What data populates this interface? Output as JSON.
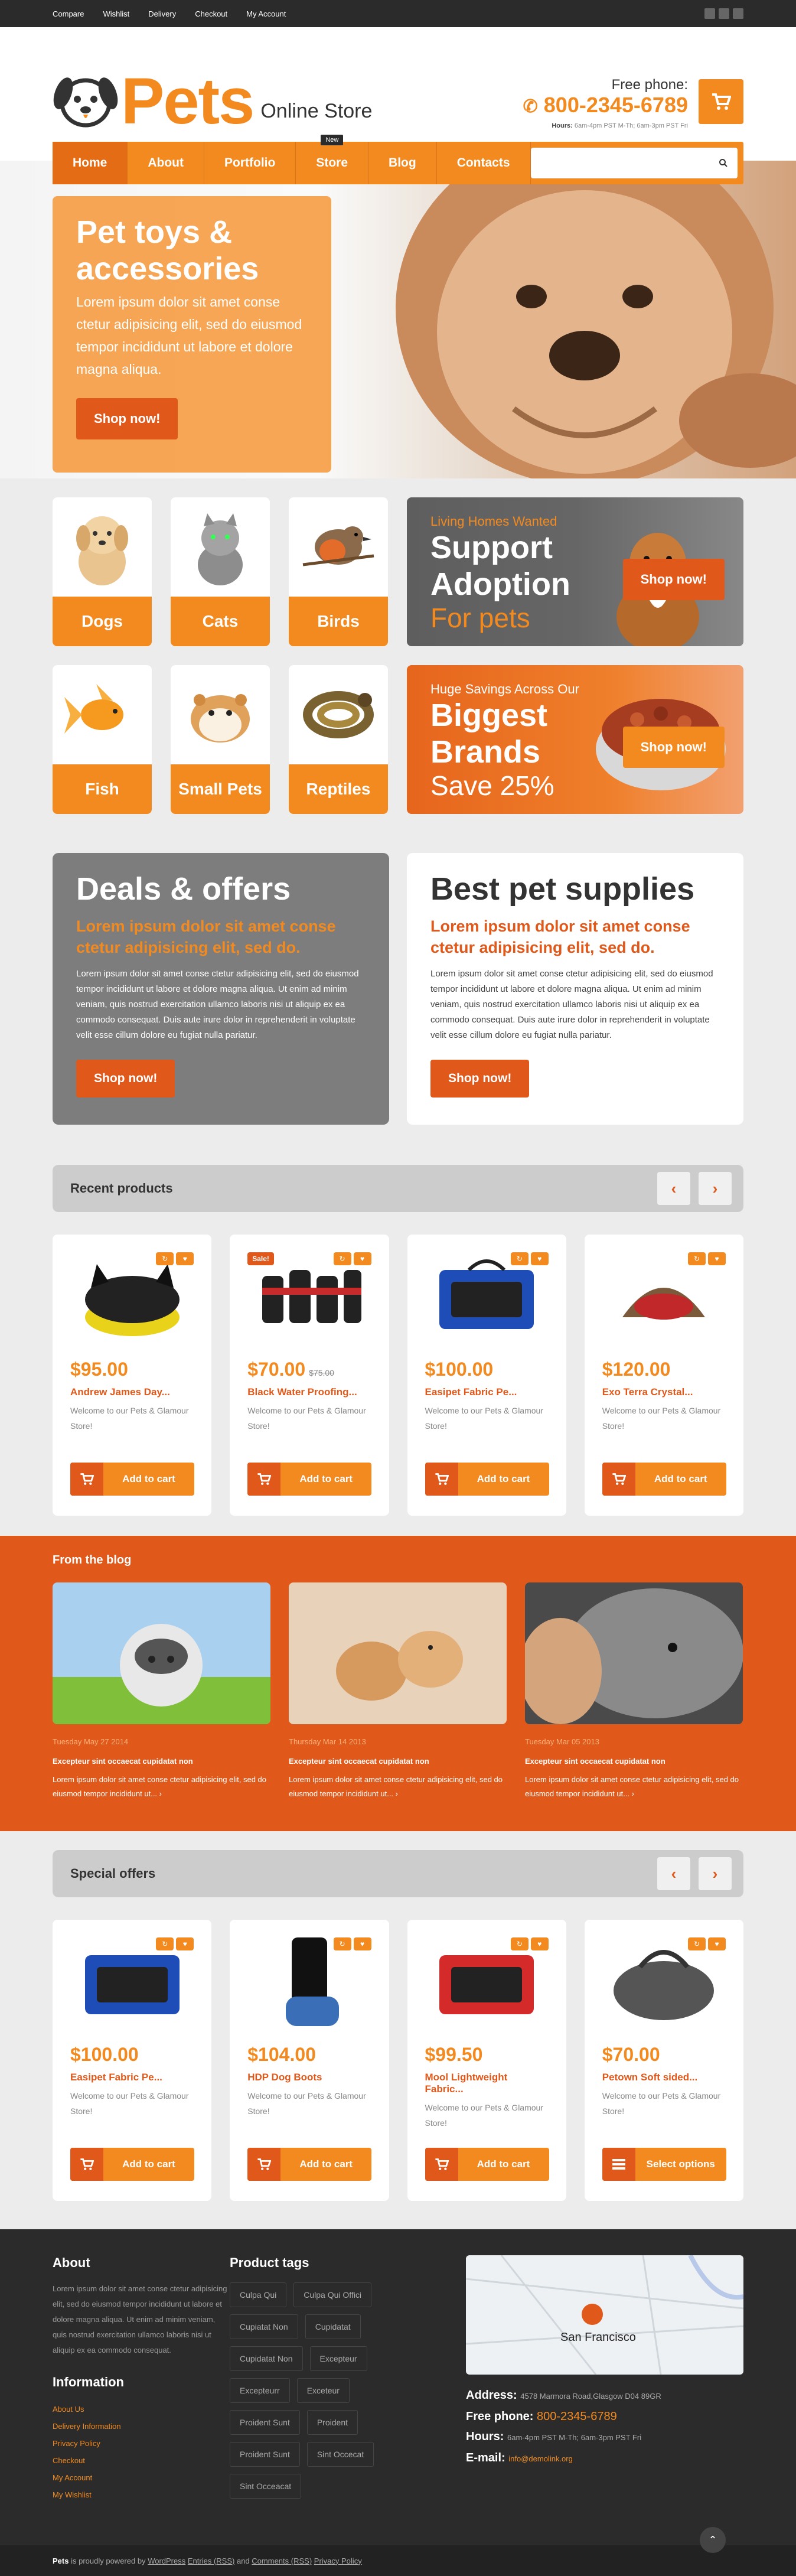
{
  "topbar": {
    "links": [
      "Compare",
      "Wishlist",
      "Delivery",
      "Checkout",
      "My Account"
    ],
    "social": [
      "facebook-icon",
      "twitter-icon",
      "instagram-icon"
    ]
  },
  "header": {
    "logo_word": "Pets",
    "logo_sub": "Online Store",
    "phone_label": "Free phone:",
    "phone": "800-2345-6789",
    "hours_label": "Hours:",
    "hours": "6am-4pm PST M-Th; 6am-3pm PST Fri"
  },
  "nav": {
    "items": [
      "Home",
      "About",
      "Portfolio",
      "Store",
      "Blog",
      "Contacts"
    ],
    "badge": "New",
    "search_placeholder": ""
  },
  "hero": {
    "title": "Pet toys & accessories",
    "text": "Lorem ipsum dolor sit amet conse ctetur adipisicing elit, sed do eiusmod tempor incididunt ut labore et dolore magna aliqua.",
    "button": "Shop now!"
  },
  "categories": [
    "Dogs",
    "Cats",
    "Birds",
    "Fish",
    "Small Pets",
    "Reptiles"
  ],
  "promos": [
    {
      "small": "Living Homes Wanted",
      "big": "Support Adoption",
      "sub": "For pets",
      "button": "Shop now!"
    },
    {
      "small": "Huge Savings Across Our",
      "big": "Biggest Brands",
      "sub": "Save 25%",
      "button": "Shop now!"
    }
  ],
  "deals": [
    {
      "title": "Deals & offers",
      "highlight": "Lorem ipsum dolor sit amet conse ctetur adipisicing elit, sed do.",
      "text": "Lorem ipsum dolor sit amet conse ctetur adipisicing elit, sed do eiusmod tempor incididunt ut labore et dolore magna aliqua. Ut enim ad minim veniam, quis nostrud exercitation ullamco laboris nisi ut aliquip ex ea commodo consequat. Duis aute irure dolor in reprehenderit in voluptate velit esse cillum dolore eu fugiat nulla pariatur.",
      "button": "Shop now!"
    },
    {
      "title": "Best pet supplies",
      "highlight": "Lorem ipsum dolor sit amet conse ctetur adipisicing elit, sed do.",
      "text": "Lorem ipsum dolor sit amet conse ctetur adipisicing elit, sed do eiusmod tempor incididunt ut labore et dolore magna aliqua. Ut enim ad minim veniam, quis nostrud exercitation ullamco laboris nisi ut aliquip ex ea commodo consequat. Duis aute irure dolor in reprehenderit in voluptate velit esse cillum dolore eu fugiat nulla pariatur.",
      "button": "Shop now!"
    }
  ],
  "recent": {
    "title": "Recent products",
    "products": [
      {
        "price": "$95.00",
        "old": "",
        "sale": "",
        "name": "Andrew James Day...",
        "desc": "Welcome to our Pets & Glamour Store!",
        "button": "Add to cart"
      },
      {
        "price": "$70.00",
        "old": "$75.00",
        "sale": "Sale!",
        "name": "Black Water Proofing...",
        "desc": "Welcome to our Pets & Glamour Store!",
        "button": "Add to cart"
      },
      {
        "price": "$100.00",
        "old": "",
        "sale": "",
        "name": "Easipet Fabric Pe...",
        "desc": "Welcome to our Pets & Glamour Store!",
        "button": "Add to cart"
      },
      {
        "price": "$120.00",
        "old": "",
        "sale": "",
        "name": "Exo Terra Crystal...",
        "desc": "Welcome to our Pets & Glamour Store!",
        "button": "Add to cart"
      }
    ]
  },
  "blog": {
    "title": "From the blog",
    "posts": [
      {
        "date": "Tuesday May 27 2014",
        "title": "Excepteur sint occaecat cupidatat non",
        "text": "Lorem ipsum dolor sit amet conse ctetur adipisicing elit, sed do eiusmod tempor incididunt ut..."
      },
      {
        "date": "Thursday Mar 14 2013",
        "title": "Excepteur sint occaecat cupidatat non",
        "text": "Lorem ipsum dolor sit amet conse ctetur adipisicing elit, sed do eiusmod tempor incididunt ut..."
      },
      {
        "date": "Tuesday Mar 05 2013",
        "title": "Excepteur sint occaecat cupidatat non",
        "text": "Lorem ipsum dolor sit amet conse ctetur adipisicing elit, sed do eiusmod tempor incididunt ut..."
      }
    ]
  },
  "special": {
    "title": "Special offers",
    "products": [
      {
        "price": "$100.00",
        "name": "Easipet Fabric Pe...",
        "desc": "Welcome to our Pets & Glamour Store!",
        "button": "Add to cart"
      },
      {
        "price": "$104.00",
        "name": "HDP Dog Boots",
        "desc": "Welcome to our Pets & Glamour Store!",
        "button": "Add to cart"
      },
      {
        "price": "$99.50",
        "name": "Mool Lightweight Fabric...",
        "desc": "Welcome to our Pets & Glamour Store!",
        "button": "Add to cart"
      },
      {
        "price": "$70.00",
        "name": "Petown Soft sided...",
        "desc": "Welcome to our Pets & Glamour Store!",
        "button": "Select options"
      }
    ]
  },
  "footer": {
    "about_title": "About",
    "about_text": "Lorem ipsum dolor sit amet conse ctetur adipisicing elit, sed do eiusmod tempor incididunt ut labore et dolore magna aliqua. Ut enim ad minim veniam, quis nostrud exercitation ullamco laboris nisi ut aliquip ex ea commodo consequat.",
    "info_title": "Information",
    "info_links": [
      "About Us",
      "Delivery Information",
      "Privacy Policy",
      "Checkout",
      "My Account",
      "My Wishlist"
    ],
    "tags_title": "Product tags",
    "tags": [
      "Culpa Qui",
      "Culpa Qui Offici",
      "Cupiatat Non",
      "Cupidatat",
      "Cupidatat Non",
      "Excepteur",
      "Excepteurr",
      "Exceteur",
      "Proident Sunt",
      "Proident",
      "Proident Sunt",
      "Sint Occecat",
      "Sint Occeacat"
    ],
    "map_city": "San Francisco",
    "address_label": "Address:",
    "address": "4578 Marmora Road,Glasgow D04 89GR",
    "phone_label": "Free phone:",
    "phone": "800-2345-6789",
    "hours_label": "Hours:",
    "hours": "6am-4pm PST M-Th; 6am-3pm PST Fri",
    "email_label": "E-mail:",
    "email": "info@demolink.org",
    "copy_brand": "Pets",
    "copy_text": "is proudly powered by",
    "copy_links": [
      "WordPress",
      "Entries (RSS)",
      "Comments (RSS)",
      "Privacy Policy"
    ],
    "copy_and": "and"
  },
  "colors": {
    "accent": "#f28a20",
    "accent_dark": "#e0591a",
    "dark": "#2b2b2b"
  }
}
